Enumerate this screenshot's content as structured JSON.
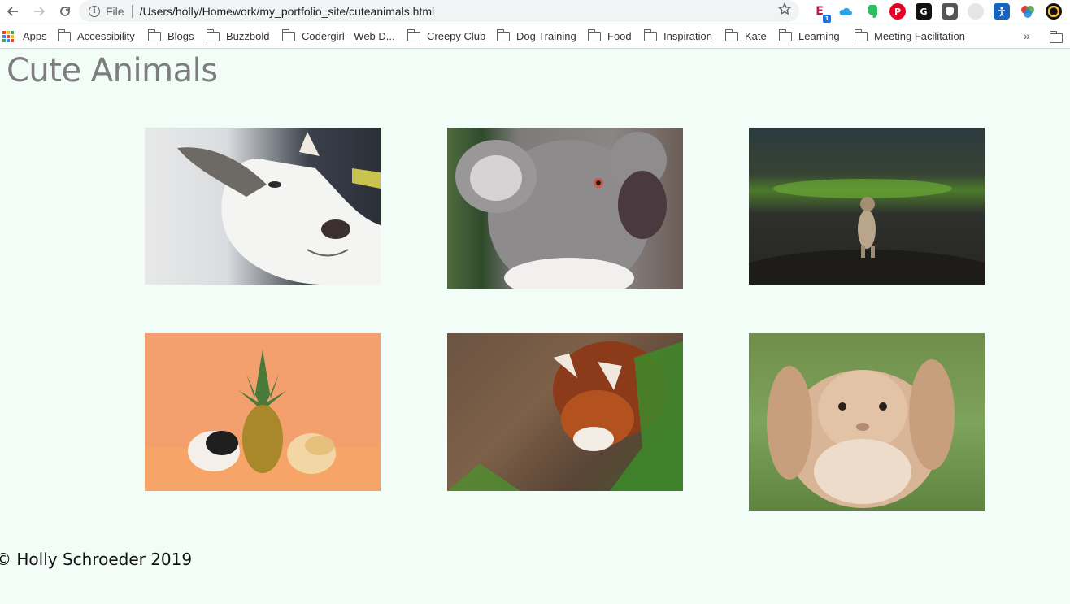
{
  "browser": {
    "scheme_label": "File",
    "url": "/Users/holly/Homework/my_portfolio_site/cuteanimals.html",
    "extension_badge": "1"
  },
  "bookmarks": {
    "apps_label": "Apps",
    "items": [
      "Accessibility",
      "Blogs",
      "Buzzbold",
      "Codergirl - Web D...",
      "Creepy Club",
      "Dog Training",
      "Food",
      "Inspiration",
      "Kate",
      "Learning",
      "Meeting Facilitation"
    ],
    "overflow_label": "»"
  },
  "page": {
    "title": "Cute Animals",
    "footer": "© Holly Schroeder 2019"
  }
}
